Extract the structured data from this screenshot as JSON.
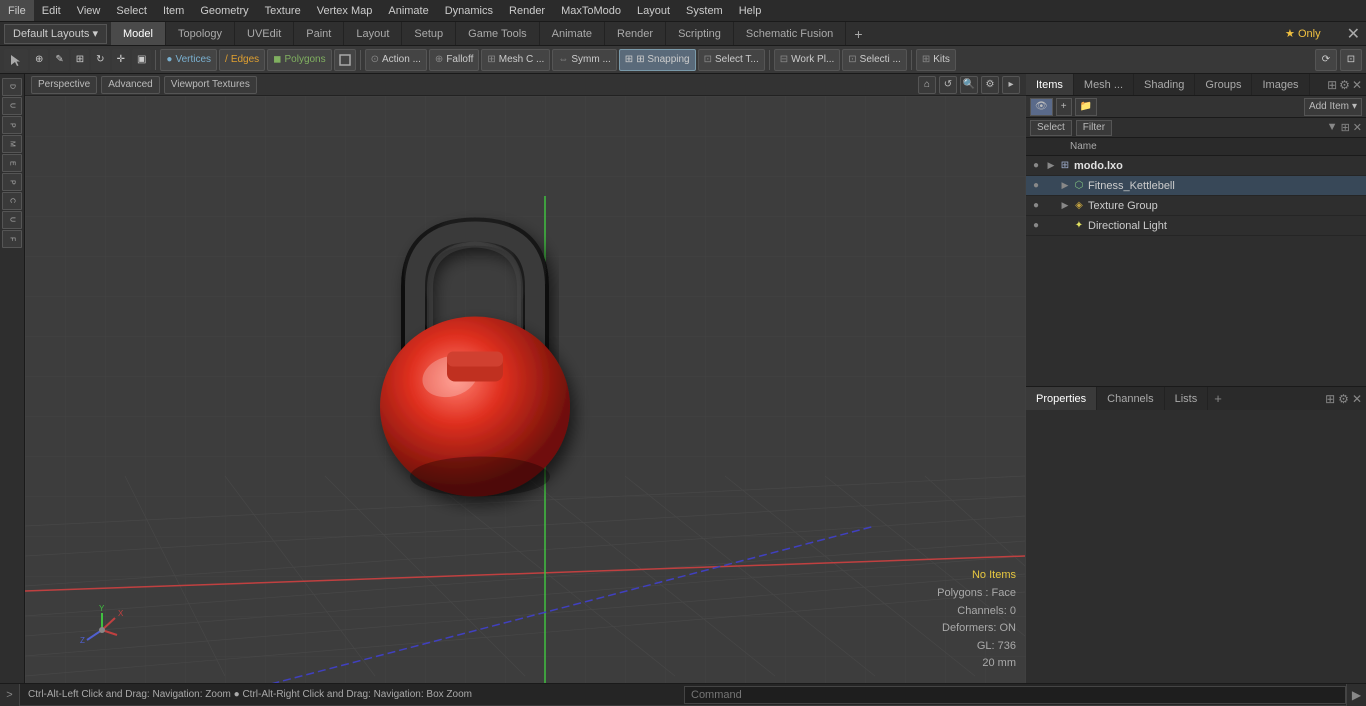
{
  "menu": {
    "items": [
      "File",
      "Edit",
      "View",
      "Select",
      "Item",
      "Geometry",
      "Texture",
      "Vertex Map",
      "Animate",
      "Dynamics",
      "Render",
      "MaxToModo",
      "Layout",
      "System",
      "Help"
    ]
  },
  "layout_bar": {
    "dropdown_label": "Default Layouts ▾",
    "tabs": [
      "Model",
      "Topology",
      "UVEdit",
      "Paint",
      "Layout",
      "Setup",
      "Game Tools",
      "Animate",
      "Render",
      "Scripting",
      "Schematic Fusion"
    ],
    "active_tab": "Model",
    "add_icon": "+",
    "star_label": "★ Only",
    "close_icon": "✕"
  },
  "toolbar": {
    "component_buttons": [
      "Vertices",
      "Edges",
      "Polygons"
    ],
    "action_label": "Action ...",
    "falloff_label": "Falloff",
    "mesh_c_label": "Mesh C ...",
    "symm_label": "Symm ...",
    "snapping_label": "⊞ Snapping",
    "select_t_label": "Select T...",
    "work_pl_label": "Work Pl...",
    "selecti_label": "Selecti ...",
    "kits_label": "Kits"
  },
  "viewport": {
    "perspective_label": "Perspective",
    "advanced_label": "Advanced",
    "viewport_textures_label": "Viewport Textures"
  },
  "status_info": {
    "no_items": "No Items",
    "polygons": "Polygons : Face",
    "channels": "Channels: 0",
    "deformers": "Deformers: ON",
    "gl": "GL: 736",
    "size": "20 mm"
  },
  "status_bar": {
    "text": "Ctrl-Alt-Left Click and Drag: Navigation: Zoom ● Ctrl-Alt-Right Click and Drag: Navigation: Box Zoom",
    "arrow": ">",
    "command_placeholder": "Command"
  },
  "right_panel": {
    "tabs": [
      "Items",
      "Mesh ...",
      "Shading",
      "Groups",
      "Images"
    ],
    "active_tab": "Items",
    "add_item_label": "Add Item",
    "select_label": "Select",
    "filter_label": "Filter",
    "name_col": "Name",
    "items": [
      {
        "id": "modo_lxo",
        "label": "modo.lxo",
        "type": "scene",
        "level": 0,
        "eye": true,
        "expanded": true
      },
      {
        "id": "fitness_kettlebell",
        "label": "Fitness_Kettlebell",
        "type": "mesh",
        "level": 1,
        "eye": true
      },
      {
        "id": "texture_group",
        "label": "Texture Group",
        "type": "texture",
        "level": 1,
        "eye": true
      },
      {
        "id": "directional_light",
        "label": "Directional Light",
        "type": "light",
        "level": 1,
        "eye": true
      }
    ]
  },
  "bottom_panel": {
    "tabs": [
      "Properties",
      "Channels",
      "Lists"
    ],
    "active_tab": "Properties",
    "add_icon": "+"
  },
  "colors": {
    "accent_blue": "#5a8ab0",
    "grid_color": "#4a4a4a",
    "axis_red": "#c04040",
    "axis_green": "#40c040",
    "axis_blue": "#4040c0",
    "status_yellow": "#e8c840"
  }
}
